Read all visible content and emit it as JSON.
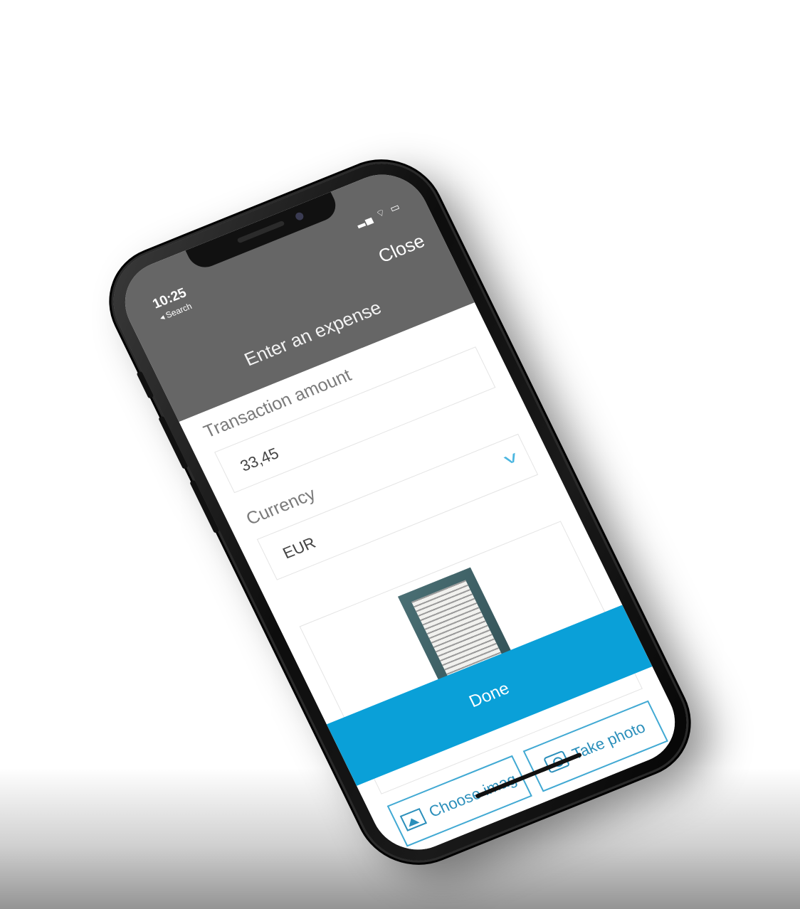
{
  "status_bar": {
    "time": "10:25",
    "back_label": "◂ Search",
    "icons": "▂▄ ⌔ ▭"
  },
  "header": {
    "title": "Enter an expense",
    "close_label": "Close"
  },
  "form": {
    "amount_label": "Transaction amount",
    "amount_value": "33,45",
    "currency_label": "Currency",
    "currency_value": "EUR"
  },
  "attachments": {
    "choose_image_label": "Choose imag",
    "take_photo_label": "Take photo"
  },
  "footer": {
    "done_label": "Done"
  },
  "colors": {
    "header_bg": "#666666",
    "accent": "#0aa0d8",
    "outline": "#41a9d3"
  }
}
